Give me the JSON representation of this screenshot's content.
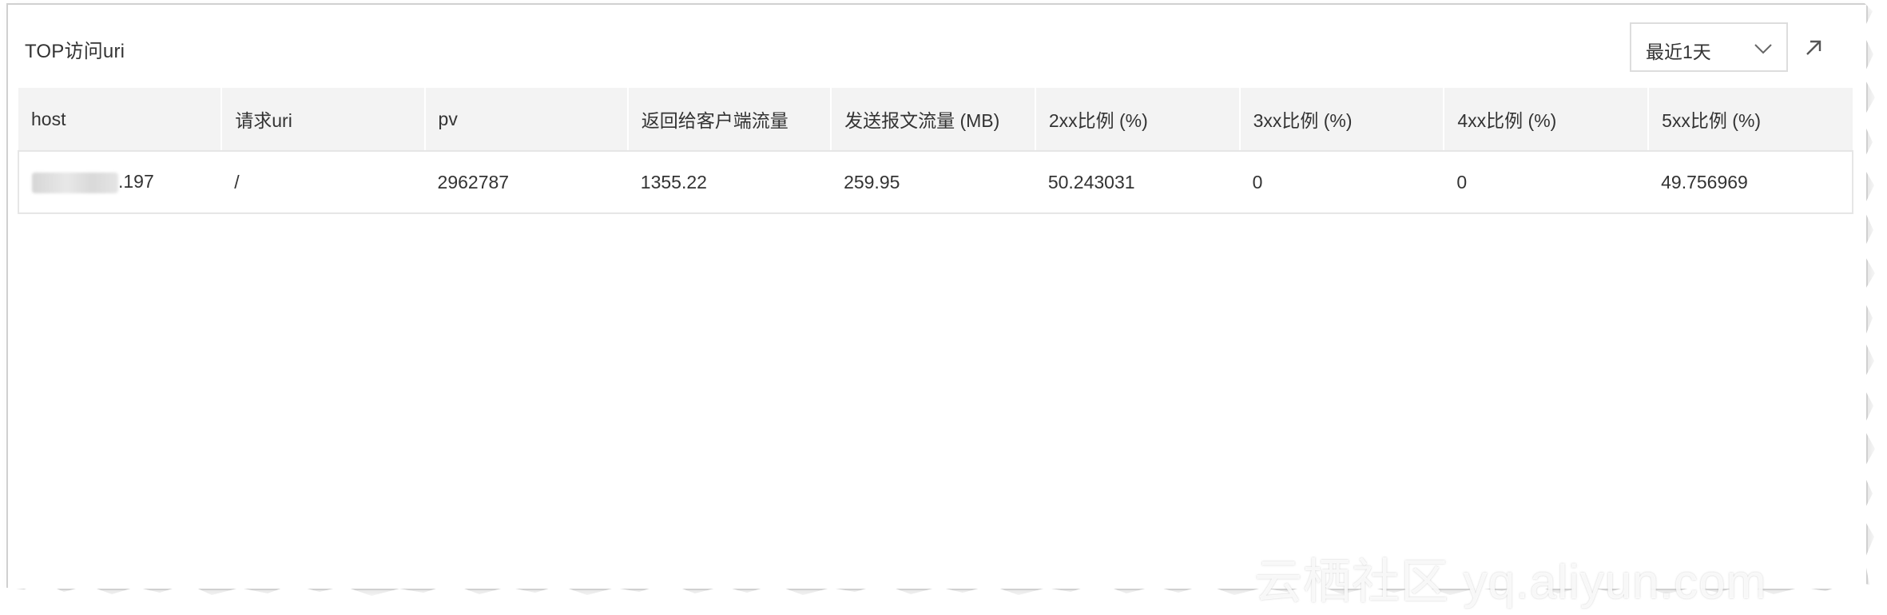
{
  "panel": {
    "title": "TOP访问uri",
    "range_select": {
      "value": "最近1天",
      "icon": "chevron-down-icon"
    },
    "expand_icon": "arrow-up-right-icon"
  },
  "table": {
    "columns": [
      "host",
      "请求uri",
      "pv",
      "返回给客户端流量",
      "发送报文流量 (MB)",
      "2xx比例 (%)",
      "3xx比例 (%)",
      "4xx比例 (%)",
      "5xx比例 (%)"
    ],
    "rows": [
      {
        "host_visible_suffix": ".197",
        "uri": "/",
        "pv": "2962787",
        "client_traffic": "1355.22",
        "sent_traffic": "259.95",
        "ratio_2xx": "50.243031",
        "ratio_3xx": "0",
        "ratio_4xx": "0",
        "ratio_5xx": "49.756969"
      }
    ]
  },
  "watermark": "云栖社区 yq.aliyun.com"
}
